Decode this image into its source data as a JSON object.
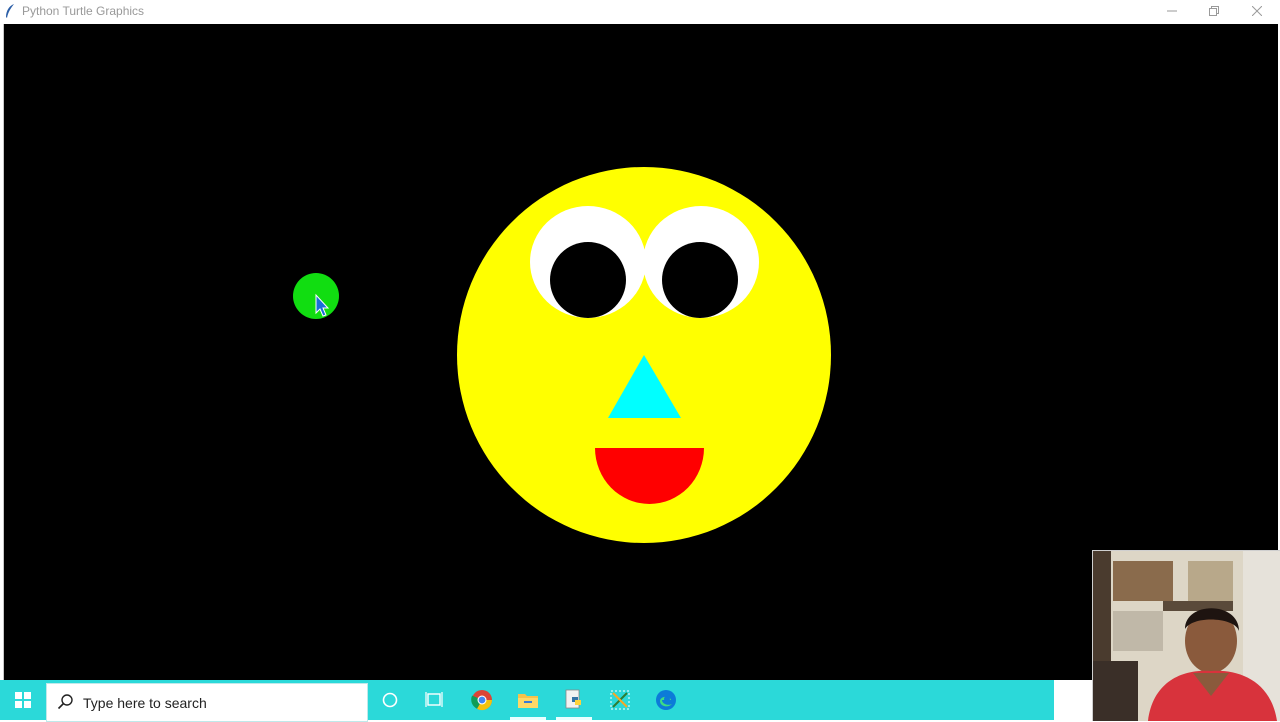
{
  "window": {
    "title": "Python Turtle Graphics",
    "controls": {
      "minimize": "minimize-icon",
      "maximize": "restore-icon",
      "close": "close-icon"
    }
  },
  "canvas": {
    "background": "#000000",
    "face_color": "#ffff00",
    "eye_white_color": "#ffffff",
    "pupil_color": "#000000",
    "nose_color": "#00ffff",
    "mouth_color": "#ff0000",
    "turtle_dot_color": "#11dd11"
  },
  "taskbar": {
    "background": "#2bd9d9",
    "search_placeholder": "Type here to search",
    "icons": [
      "windows-start-icon",
      "search-icon",
      "cortana-icon",
      "task-view-icon",
      "chrome-icon",
      "file-explorer-icon",
      "python-icon",
      "snipping-tool-icon",
      "edge-icon"
    ]
  },
  "webcam": {
    "label": "webcam-overlay"
  }
}
